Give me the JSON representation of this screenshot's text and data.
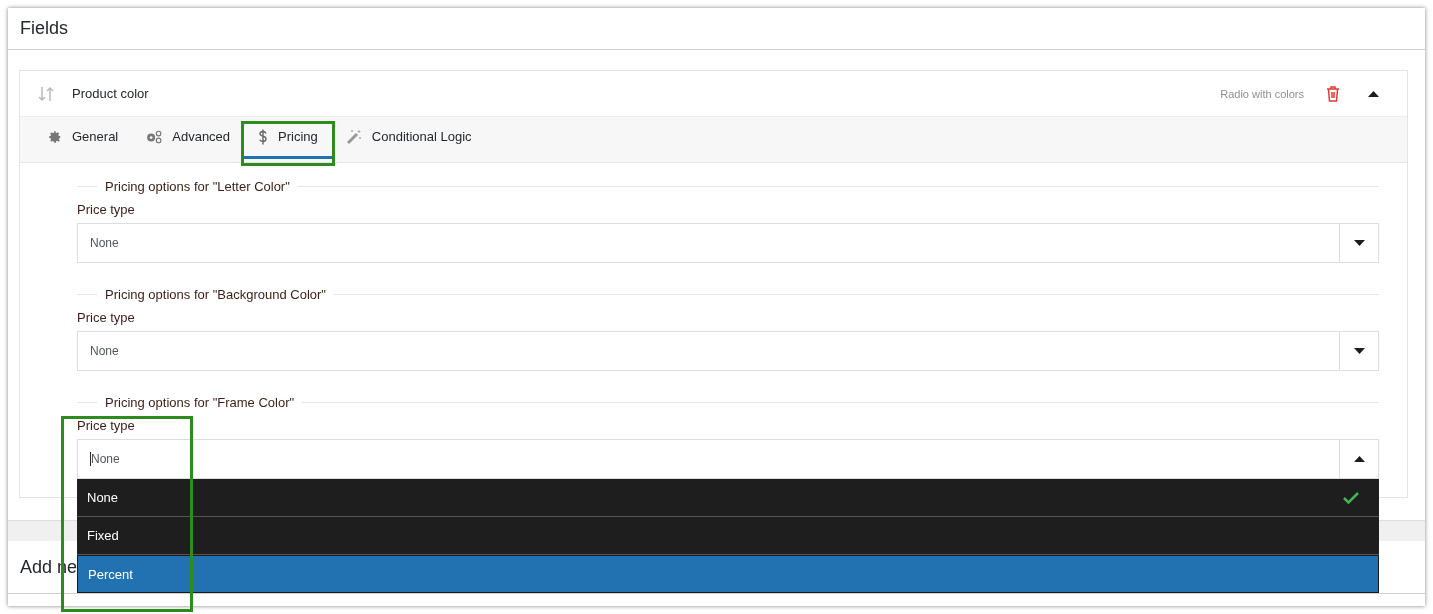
{
  "panel": {
    "title": "Fields"
  },
  "field": {
    "name": "Product color",
    "type_label": "Radio with colors",
    "expanded": true
  },
  "tabs": [
    {
      "kind": "gear",
      "label": "General",
      "selected": false,
      "highlighted": false
    },
    {
      "kind": "gears",
      "label": "Advanced",
      "selected": false,
      "highlighted": false
    },
    {
      "kind": "dollar",
      "label": "Pricing",
      "selected": true,
      "highlighted": true
    },
    {
      "kind": "wand",
      "label": "Conditional Logic",
      "selected": false,
      "highlighted": false
    }
  ],
  "sections": [
    {
      "legend": "Pricing options for \"Letter Color\"",
      "label": "Price type",
      "value": "None",
      "open": false,
      "highlighted": false
    },
    {
      "legend": "Pricing options for \"Background Color\"",
      "label": "Price type",
      "value": "None",
      "open": false,
      "highlighted": false
    },
    {
      "legend": "Pricing options for \"Frame Color\"",
      "label": "Price type",
      "value": "None",
      "open": true,
      "highlighted": true
    }
  ],
  "dropdown": {
    "options": [
      {
        "label": "None",
        "selected": true,
        "hovered": false
      },
      {
        "label": "Fixed",
        "selected": false,
        "hovered": false
      },
      {
        "label": "Percent",
        "selected": false,
        "hovered": true
      }
    ]
  },
  "footer": {
    "title": "Add ne"
  }
}
